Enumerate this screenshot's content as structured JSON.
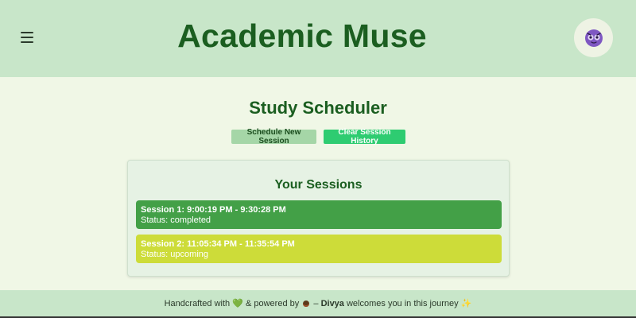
{
  "header": {
    "title": "Academic Muse",
    "menu_icon": "hamburger-menu-icon",
    "avatar_icon": "purple-owl-avatar-icon"
  },
  "main": {
    "title": "Study Scheduler",
    "schedule_button": "Schedule New Session",
    "clear_button": "Clear Session History"
  },
  "sessions": {
    "title": "Your Sessions",
    "items": [
      {
        "title": "Session 1: 9:00:19 PM - 9:30:28 PM",
        "status": "Status: completed",
        "color": "#43a047"
      },
      {
        "title": "Session 2: 11:05:34 PM - 11:35:54 PM",
        "status": "Status: upcoming",
        "color": "#cddc39"
      }
    ]
  },
  "footer": {
    "prefix": "Handcrafted with",
    "middle": "& powered by",
    "dash": "–",
    "name": "Divya",
    "suffix": "welcomes you in this journey",
    "heart_icon": "💚",
    "coffee_icon": "coffee-icon",
    "sparkle_icon": "✨"
  },
  "colors": {
    "header_bg": "#c8e6c9",
    "page_bg": "#f0f7e6",
    "title_green": "#1b5e20",
    "clear_button_bg": "#2ecc71",
    "schedule_button_bg": "#a5d6a7"
  }
}
